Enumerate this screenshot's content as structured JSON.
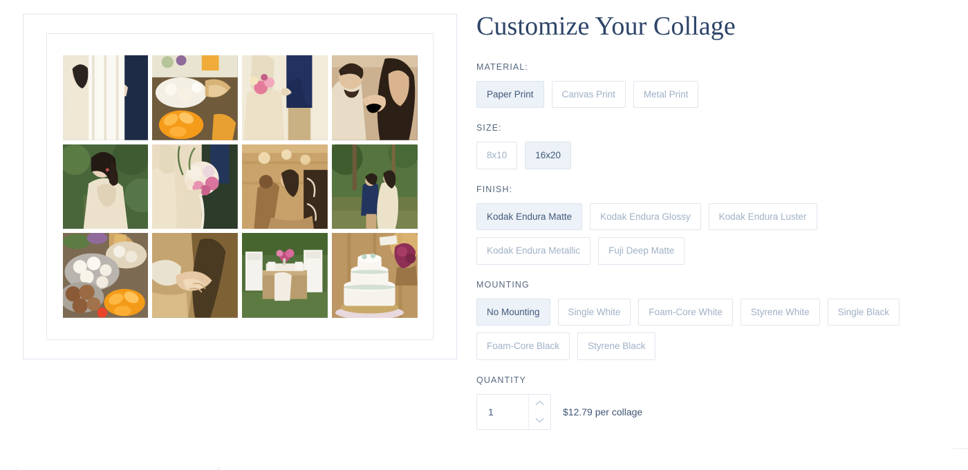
{
  "header": {
    "title": "Customize Your Collage"
  },
  "preview": {
    "alt": "wedding photo collage preview",
    "rows": 3,
    "columns": 4,
    "tiles": [
      {
        "name": "bride-and-groom-holding-hands",
        "palette": [
          "#f3efe6",
          "#1f2a44",
          "#d8c9a8"
        ]
      },
      {
        "name": "dessert-table-with-oranges",
        "palette": [
          "#e7d9b8",
          "#f0a52a",
          "#8a6a3a"
        ]
      },
      {
        "name": "couple-in-navy-suit-and-dress",
        "palette": [
          "#ece3cf",
          "#20325c",
          "#c9b183"
        ]
      },
      {
        "name": "groom-kissing-brides-hand",
        "palette": [
          "#cbb08c",
          "#5a4230",
          "#e4d3ba"
        ]
      },
      {
        "name": "bride-in-backless-dress",
        "palette": [
          "#3e5a32",
          "#e9dfc6",
          "#70865c"
        ]
      },
      {
        "name": "bridal-bouquet-closeup",
        "palette": [
          "#e8dcc4",
          "#e07f9c",
          "#4b6140"
        ]
      },
      {
        "name": "couple-sitting-by-chalkboard",
        "palette": [
          "#c9a濃",
          "#c9a36b",
          "#4a3724"
        ]
      },
      {
        "name": "couple-walking-in-forest",
        "palette": [
          "#4a6b3c",
          "#23365f",
          "#ded2b8"
        ]
      },
      {
        "name": "dessert-platter-with-oranges",
        "palette": [
          "#8d7a63",
          "#f0a52a",
          "#ece4d4"
        ]
      },
      {
        "name": "holding-hands-closeup",
        "palette": [
          "#a08556",
          "#e6dcc8",
          "#6b5536"
        ]
      },
      {
        "name": "reception-table-and-chairs",
        "palette": [
          "#4f6a3c",
          "#b49a6a",
          "#f2efe6"
        ]
      },
      {
        "name": "wedding-cake-with-flowers",
        "palette": [
          "#c9a678",
          "#f4f1ea",
          "#8e2f55"
        ]
      }
    ]
  },
  "options": {
    "material": {
      "label": "MATERIAL:",
      "choices": [
        {
          "label": "Paper Print",
          "selected": true
        },
        {
          "label": "Canvas Print",
          "selected": false
        },
        {
          "label": "Metal Print",
          "selected": false
        }
      ]
    },
    "size": {
      "label": "SIZE:",
      "choices": [
        {
          "label": "8x10",
          "selected": false
        },
        {
          "label": "16x20",
          "selected": true
        }
      ]
    },
    "finish": {
      "label": "FINISH:",
      "choices": [
        {
          "label": "Kodak Endura Matte",
          "selected": true
        },
        {
          "label": "Kodak Endura Glossy",
          "selected": false
        },
        {
          "label": "Kodak Endura Luster",
          "selected": false
        },
        {
          "label": "Kodak Endura Metallic",
          "selected": false
        },
        {
          "label": "Fuji Deep Matte",
          "selected": false
        }
      ]
    },
    "mounting": {
      "label": "MOUNTING",
      "choices": [
        {
          "label": "No Mounting",
          "selected": true
        },
        {
          "label": "Single White",
          "selected": false
        },
        {
          "label": "Foam-Core White",
          "selected": false
        },
        {
          "label": "Styrene White",
          "selected": false
        },
        {
          "label": "Single Black",
          "selected": false
        },
        {
          "label": "Foam-Core Black",
          "selected": false
        },
        {
          "label": "Styrene Black",
          "selected": false
        }
      ]
    },
    "quantity": {
      "label": "QUANTITY",
      "value": "1",
      "placeholder": "1",
      "price_text": "$12.79 per collage",
      "increment_icon": "chevron-up-icon",
      "decrement_icon": "chevron-down-icon"
    }
  },
  "colors": {
    "title": "#2d4468",
    "label": "#55677e",
    "selected_bg": "#edf2f8",
    "selected_text": "#41597a",
    "unselected_text": "#9fb1c6",
    "border": "#dfe6ee",
    "price_text": "#3f5473"
  }
}
